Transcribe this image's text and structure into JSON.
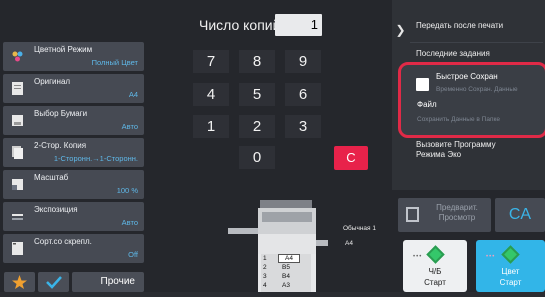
{
  "copies": {
    "label": "Число копий",
    "value": "1"
  },
  "keypad": {
    "keys": [
      "7",
      "8",
      "9",
      "4",
      "5",
      "6",
      "1",
      "2",
      "3",
      "0"
    ],
    "clear": "C"
  },
  "functions": [
    {
      "title": "Цветной Режим",
      "value": "Полный Цвет",
      "icon": "color-mode-icon"
    },
    {
      "title": "Оригинал",
      "value": "A4",
      "icon": "original-icon"
    },
    {
      "title": "Выбор Бумаги",
      "value": "Авто",
      "icon": "paper-select-icon"
    },
    {
      "title": "2-Стор. Копия",
      "value": "1-Сторонн.→1-Сторонн.",
      "icon": "duplex-icon"
    },
    {
      "title": "Масштаб",
      "value": "100 %",
      "icon": "zoom-icon"
    },
    {
      "title": "Экспозиция",
      "value": "Авто",
      "icon": "exposure-icon"
    },
    {
      "title": "Сорт.со скрепл.",
      "value": "Off",
      "icon": "sort-staple-icon"
    }
  ],
  "bottom_left": {
    "preview": "Прочие"
  },
  "printer": {
    "paper_label": "Обычная 1",
    "paper_size": "A4",
    "trays": [
      {
        "n": "1",
        "size": "A4"
      },
      {
        "n": "2",
        "size": "B5"
      },
      {
        "n": "3",
        "size": "B4"
      },
      {
        "n": "4",
        "size": "A3"
      }
    ]
  },
  "right_panel": {
    "send_after_print": "Передать после печати",
    "recent_jobs": "Последние задания",
    "quick_save_title": "Быстрое Сохран",
    "quick_save_sub": "Временно Сохран. Данные",
    "file_title": "Файл",
    "file_sub": "Сохранить Данные в Папке",
    "eco_line1": "Вызовите Программу",
    "eco_line2": "Режима Эко"
  },
  "preview_btn": {
    "line1": "Предварит.",
    "line2": "Просмотр"
  },
  "ca_label": "CA",
  "start_bw": {
    "line1": "Ч/Б",
    "line2": "Старт"
  },
  "start_color": {
    "line1": "Цвет",
    "line2": "Старт"
  },
  "colors": {
    "accent_red": "#e02a47",
    "accent_blue": "#32b5e8",
    "link_blue": "#5fb8e8"
  }
}
